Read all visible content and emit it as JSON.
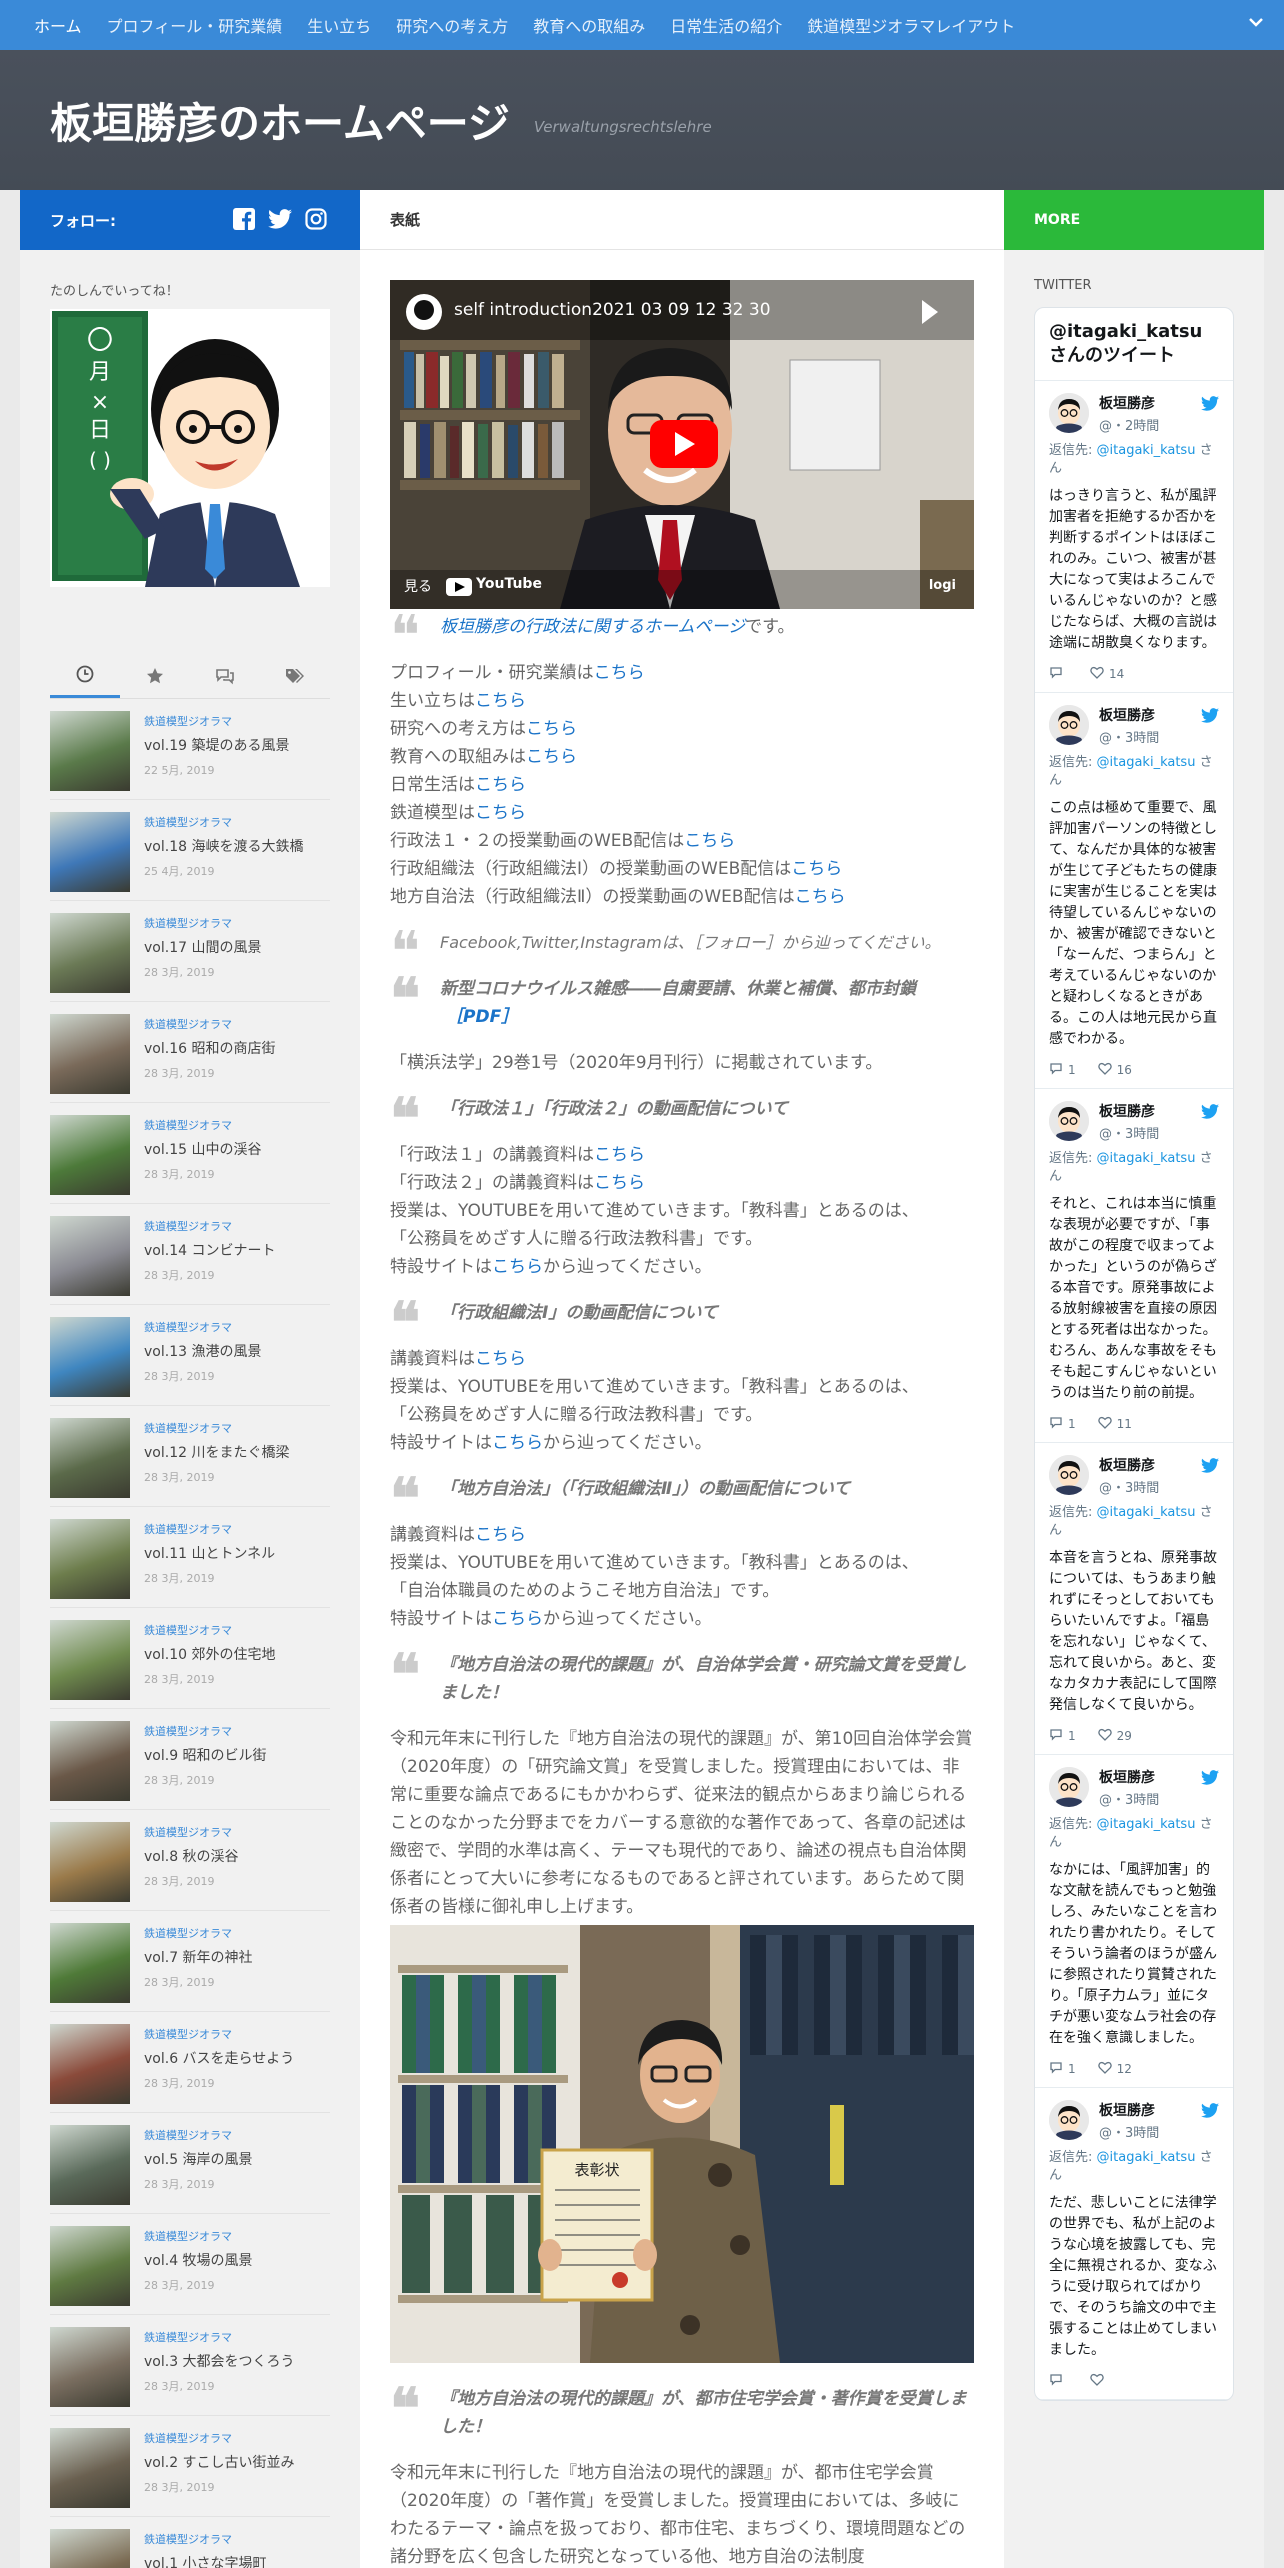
{
  "nav": {
    "items": [
      "ホーム",
      "プロフィール・研究業績",
      "生い立ち",
      "研究への考え方",
      "教育への取組み",
      "日常生活の紹介",
      "鉄道模型ジオラマレイアウト"
    ]
  },
  "header": {
    "title": "板垣勝彦のホームページ",
    "tagline": "Verwaltungsrechtslehre"
  },
  "subbar": {
    "follow_label": "フォロー:",
    "page_title": "表紙",
    "more_label": "MORE"
  },
  "sidebar": {
    "label": "たのしんでいってね！",
    "posts": [
      {
        "cat": "鉄道模型ジオラマ",
        "title": "vol.19 築堤のある風景",
        "date": "22 5月, 2019",
        "color": "#5a7a4a"
      },
      {
        "cat": "鉄道模型ジオラマ",
        "title": "vol.18 海峡を渡る大鉄橋",
        "date": "25 4月, 2019",
        "color": "#3f78b8"
      },
      {
        "cat": "鉄道模型ジオラマ",
        "title": "vol.17 山間の風景",
        "date": "28 3月, 2019",
        "color": "#6b7a56"
      },
      {
        "cat": "鉄道模型ジオラマ",
        "title": "vol.16 昭和の商店街",
        "date": "28 3月, 2019",
        "color": "#7a6a5a"
      },
      {
        "cat": "鉄道模型ジオラマ",
        "title": "vol.15 山中の渓谷",
        "date": "28 3月, 2019",
        "color": "#4d7a3a"
      },
      {
        "cat": "鉄道模型ジオラマ",
        "title": "vol.14 コンビナート",
        "date": "28 3月, 2019",
        "color": "#8a8a92"
      },
      {
        "cat": "鉄道模型ジオラマ",
        "title": "vol.13 漁港の風景",
        "date": "28 3月, 2019",
        "color": "#3f86c0"
      },
      {
        "cat": "鉄道模型ジオラマ",
        "title": "vol.12 川をまたぐ橋梁",
        "date": "28 3月, 2019",
        "color": "#5b6a4a"
      },
      {
        "cat": "鉄道模型ジオラマ",
        "title": "vol.11 山とトンネル",
        "date": "28 3月, 2019",
        "color": "#6d7d4c"
      },
      {
        "cat": "鉄道模型ジオラマ",
        "title": "vol.10 郊外の住宅地",
        "date": "28 3月, 2019",
        "color": "#6f8a4e"
      },
      {
        "cat": "鉄道模型ジオラマ",
        "title": "vol.9 昭和のビル街",
        "date": "28 3月, 2019",
        "color": "#6a5848"
      },
      {
        "cat": "鉄道模型ジオラマ",
        "title": "vol.8 秋の渓谷",
        "date": "28 3月, 2019",
        "color": "#9a7a4a"
      },
      {
        "cat": "鉄道模型ジオラマ",
        "title": "vol.7 新年の神社",
        "date": "28 3月, 2019",
        "color": "#4f7a38"
      },
      {
        "cat": "鉄道模型ジオラマ",
        "title": "vol.6 バスを走らせよう",
        "date": "28 3月, 2019",
        "color": "#8a4a3a"
      },
      {
        "cat": "鉄道模型ジオラマ",
        "title": "vol.5 海岸の風景",
        "date": "28 3月, 2019",
        "color": "#5a6a5a"
      },
      {
        "cat": "鉄道模型ジオラマ",
        "title": "vol.4 牧場の風景",
        "date": "28 3月, 2019",
        "color": "#5f7a42"
      },
      {
        "cat": "鉄道模型ジオラマ",
        "title": "vol.3 大都会をつくろう",
        "date": "28 3月, 2019",
        "color": "#7a6e60"
      },
      {
        "cat": "鉄道模型ジオラマ",
        "title": "vol.2 すこし古い街並み",
        "date": "28 3月, 2019",
        "color": "#6a6050"
      },
      {
        "cat": "鉄道模型ジオラマ",
        "title": "vol.1 小さな字場町",
        "date": "",
        "color": "#7a6a52"
      }
    ]
  },
  "main": {
    "video_title": "self introduction2021 03 09 12 32 30",
    "video_watch": "見る",
    "video_brand": "YouTube",
    "video_logi": "logi",
    "intro_link": "板垣勝彦の行政法に関するホームページ",
    "intro_suffix": "です。",
    "links": [
      {
        "pre": "プロフィール・研究業績は",
        "link": "こちら"
      },
      {
        "pre": "生い立ちは",
        "link": "こちら"
      },
      {
        "pre": "研究への考え方は",
        "link": "こちら"
      },
      {
        "pre": "教育への取組みは",
        "link": "こちら"
      },
      {
        "pre": "日常生活は",
        "link": "こちら"
      },
      {
        "pre": "鉄道模型は",
        "link": "こちら"
      },
      {
        "pre": "行政法１・２の授業動画のWEB配信は",
        "link": "こちら"
      },
      {
        "pre": "行政組織法（行政組織法Ⅰ）の授業動画のWEB配信は",
        "link": "こちら"
      },
      {
        "pre": "地方自治法（行政組織法Ⅱ）の授業動画のWEB配信は",
        "link": "こちら"
      }
    ],
    "follow_note": "Facebook,Twitter,Instagramは、［フォロー］から辿ってください。",
    "covid_title": "新型コロナウイルス雑感――自粛要請、休業と補償、都市封鎖",
    "covid_pdf": "［PDF］",
    "covid_source": "「横浜法学」29巻1号（2020年9月刊行）に掲載されています。",
    "gyosei_title": "「行政法１」「行政法２」の動画配信について",
    "gyosei_l1_pre": "「行政法１」の講義資料は",
    "gyosei_l2_pre": "「行政法２」の講義資料は",
    "link_word": "こちら",
    "gyosei_text1": "授業は、YOUTUBEを用いて進めていきます。「教科書」とあるのは、",
    "gyosei_text2": "「公務員をめざす人に贈る行政法教科書」です。",
    "special_pre": "特設サイトは",
    "special_post": "から辿ってください。",
    "soshiki_title": "「行政組織法Ⅰ」の動画配信について",
    "lecture_pre": "講義資料は",
    "soshiki_text1": "授業は、YOUTUBEを用いて進めていきます。「教科書」とあるのは、",
    "soshiki_text2": "「公務員をめざす人に贈る行政法教科書」です。",
    "chiho_title": "「地方自治法」（「行政組織法Ⅱ」）の動画配信について",
    "chiho_text1": "授業は、YOUTUBEを用いて進めていきます。「教科書」とあるのは、",
    "chiho_text2": "「自治体職員のためのようこそ地方自治法」です。",
    "award1_title": "『地方自治法の現代的課題』が、自治体学会賞・研究論文賞を受賞しました！",
    "award1_body": "令和元年末に刊行した『地方自治法の現代的課題』が、第10回自治体学会賞（2020年度）の「研究論文賞」を受賞しました。授賞理由においては、非常に重要な論点であるにもかかわらず、従来法的観点からあまり論じられることのなかった分野までをカバーする意欲的な著作であって、各章の記述は緻密で、学問的水準は高く、テーマも現代的であり、論述の視点も自治体関係者にとって大いに参考になるものであると評されています。あらためて関係者の皆様に御礼申し上げます。",
    "certificate": "表彰状",
    "award2_title": "『地方自治法の現代的課題』が、都市住宅学会賞・著作賞を受賞しました！",
    "award2_body": "令和元年末に刊行した『地方自治法の現代的課題』が、都市住宅学会賞（2020年度）の「著作賞」を受賞しました。授賞理由においては、多岐にわたるテーマ・論点を扱っており、都市住宅、まちづくり、環境問題などの諸分野を広く包含した研究となっている他、地方自治の法制度"
  },
  "twitter": {
    "label": "TWITTER",
    "header": "@itagaki_katsuさんのツイート",
    "reply_prefix": "返信先:",
    "reply_handle": "@itagaki_katsu",
    "reply_suffix": "さん",
    "tweets": [
      {
        "name": "板垣勝彦",
        "time": "@・2時間",
        "body": "はっきり言うと、私が風評加害者を拒絶するか否かを判断するポイントはほぼこれのみ。こいつ、被害が甚大になって実はよろこんでいるんじゃないのか？と感じたならば、大概の言説は途端に胡散臭くなります。",
        "replies": "",
        "likes": "14"
      },
      {
        "name": "板垣勝彦",
        "time": "@・3時間",
        "body": "この点は極めて重要で、風評加害パーソンの特徴として、なんだか具体的な被害が生じて子どもたちの健康に実害が生じることを実は待望しているんじゃないのか、被害が確認できないと「なーんだ、つまらん」と考えているんじゃないのかと疑わしくなるときがある。この人は地元民から直感でわかる。",
        "replies": "1",
        "likes": "16"
      },
      {
        "name": "板垣勝彦",
        "time": "@・3時間",
        "body": "それと、これは本当に慎重な表現が必要ですが、「事故がこの程度で収まってよかった」というのが偽らざる本音です。原発事故による放射線被害を直接の原因とする死者は出なかった。むろん、あんな事故をそもそも起こすんじゃないというのは当たり前の前提。",
        "replies": "1",
        "likes": "11"
      },
      {
        "name": "板垣勝彦",
        "time": "@・3時間",
        "body": "本音を言うとね、原発事故については、もうあまり触れずにそっとしておいてもらいたいんですよ。「福島を忘れない」じゃなくて、忘れて良いから。あと、変なカタカナ表記にして国際発信しなくて良いから。",
        "replies": "1",
        "likes": "29"
      },
      {
        "name": "板垣勝彦",
        "time": "@・3時間",
        "body": "なかには、「風評加害」的な文献を読んでもっと勉強しろ、みたいなことを言われたり書かれたり。そしてそういう論者のほうが盛んに参照されたり賞賛されたり。「原子力ムラ」並にタチが悪い変なムラ社会の存在を強く意識しました。",
        "replies": "1",
        "likes": "12"
      },
      {
        "name": "板垣勝彦",
        "time": "@・3時間",
        "body": "ただ、悲しいことに法律学の世界でも、私が上記のような心境を披露しても、完全に無視されるか、変なふうに受け取られてばかりで、そのうち論文の中で主張することは止めてしまいました。",
        "replies": "",
        "likes": ""
      }
    ]
  }
}
